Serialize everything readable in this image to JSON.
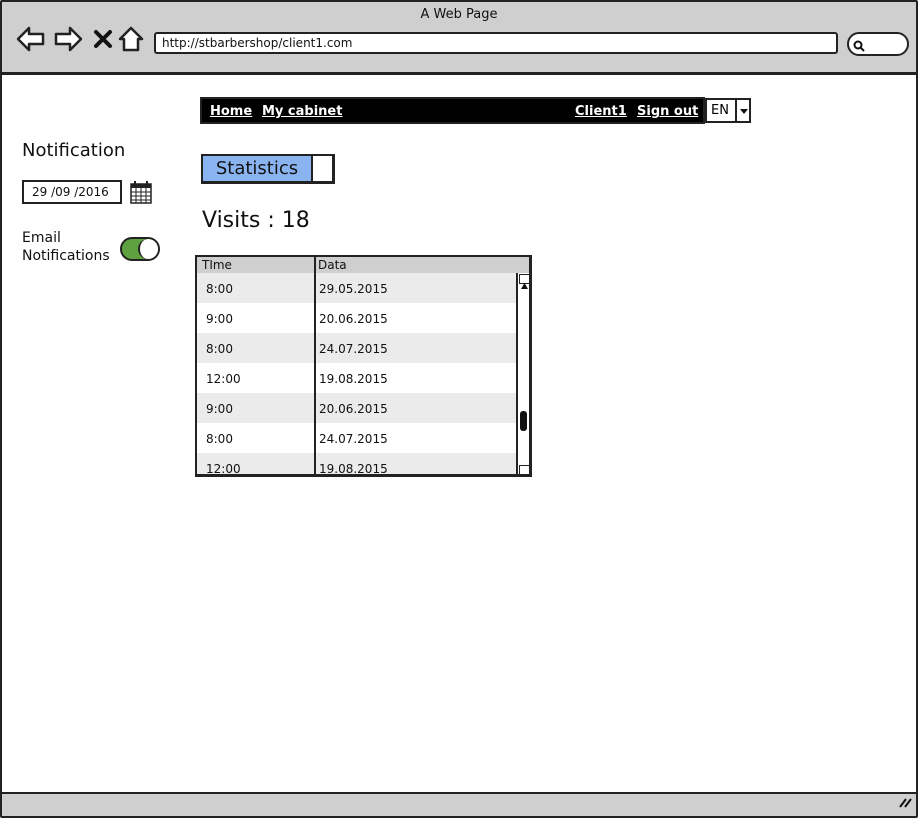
{
  "window": {
    "title": "A Web Page"
  },
  "browser": {
    "url": "http://stbarbershop/client1.com"
  },
  "menu": {
    "home": "Home",
    "cabinet": "My cabinet",
    "client": "Client1",
    "signout": "Sign out",
    "language": "EN"
  },
  "sidebar": {
    "title": "Notification",
    "date": "29 /09  /2016",
    "email_label_1": "Email",
    "email_label_2": "Notifications",
    "email_toggle_on": true
  },
  "tab": {
    "label": "Statistics"
  },
  "visits": {
    "text": "Visits : 18"
  },
  "table": {
    "headers": [
      "TIme",
      "Data"
    ],
    "rows": [
      [
        "8:00",
        "29.05.2015"
      ],
      [
        "9:00",
        "20.06.2015"
      ],
      [
        "8:00",
        "24.07.2015"
      ],
      [
        "12:00",
        "19.08.2015"
      ],
      [
        "9:00",
        "20.06.2015"
      ],
      [
        "8:00",
        "24.07.2015"
      ],
      [
        "12:00",
        "19.08.2015"
      ]
    ]
  },
  "colors": {
    "toggle_on": "#5fa041",
    "tab_active": "#8ab4f0",
    "menubar": "#000000"
  }
}
